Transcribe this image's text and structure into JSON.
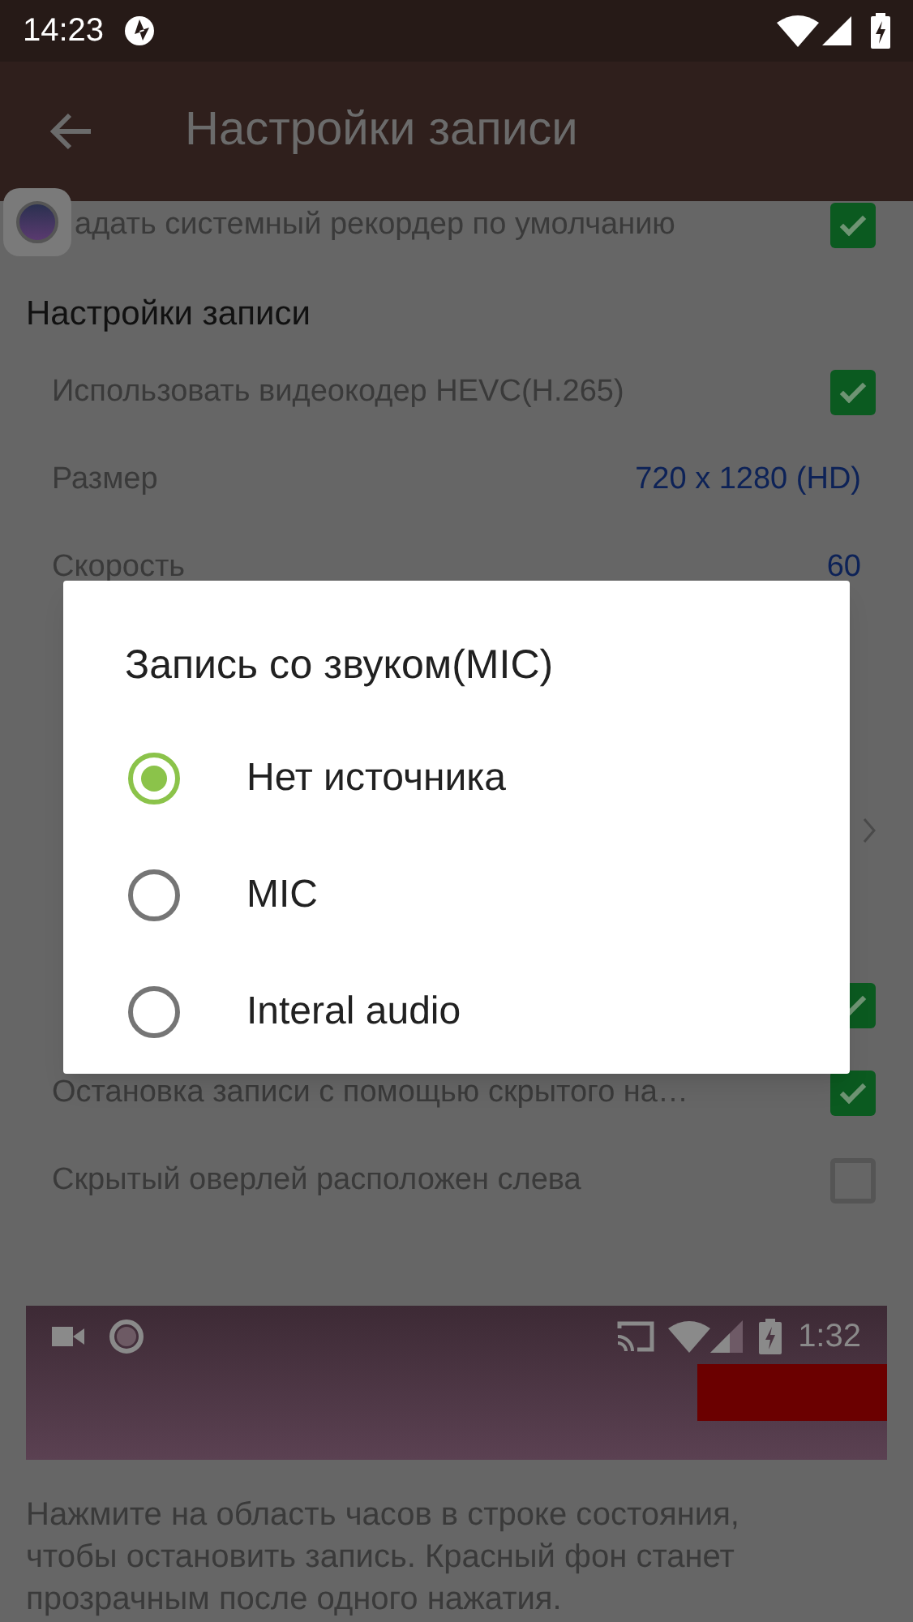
{
  "status_bar": {
    "time": "14:23"
  },
  "app_bar": {
    "title": "Настройки записи"
  },
  "sections": [
    {
      "items": [
        {
          "kind": "checkbox",
          "label": "адать системный рекордер по умолчанию",
          "checked": true
        }
      ]
    },
    {
      "title": "Настройки записи",
      "items": [
        {
          "kind": "checkbox",
          "label": "Использовать видеокодер HEVC(H.265)",
          "checked": true
        },
        {
          "kind": "value",
          "label": "Размер",
          "value": "720 x 1280 (HD)"
        },
        {
          "kind": "value",
          "label": "Скорость",
          "value": "60"
        },
        {
          "kind": "value"
        },
        {
          "kind": "value"
        },
        {
          "kind": "link"
        }
      ]
    },
    {
      "items": [
        {
          "kind": "checkbox",
          "checked": true
        },
        {
          "kind": "checkbox",
          "label": "Остановка записи с помощью скрытого на…",
          "checked": true
        },
        {
          "kind": "checkbox",
          "label": "Скрытый оверлей расположен слева",
          "checked": false
        }
      ]
    }
  ],
  "preview": {
    "time": "1:32"
  },
  "footer_text": "Нажмите на область часов в строке состояния, чтобы остановить запись. Красный фон станет прозрачным после одного нажатия.",
  "dialog": {
    "title": "Запись со звуком(MIC)",
    "options": [
      {
        "label": "Нет источника",
        "selected": true
      },
      {
        "label": "MIC",
        "selected": false
      },
      {
        "label": "Interal audio",
        "selected": false
      }
    ]
  }
}
